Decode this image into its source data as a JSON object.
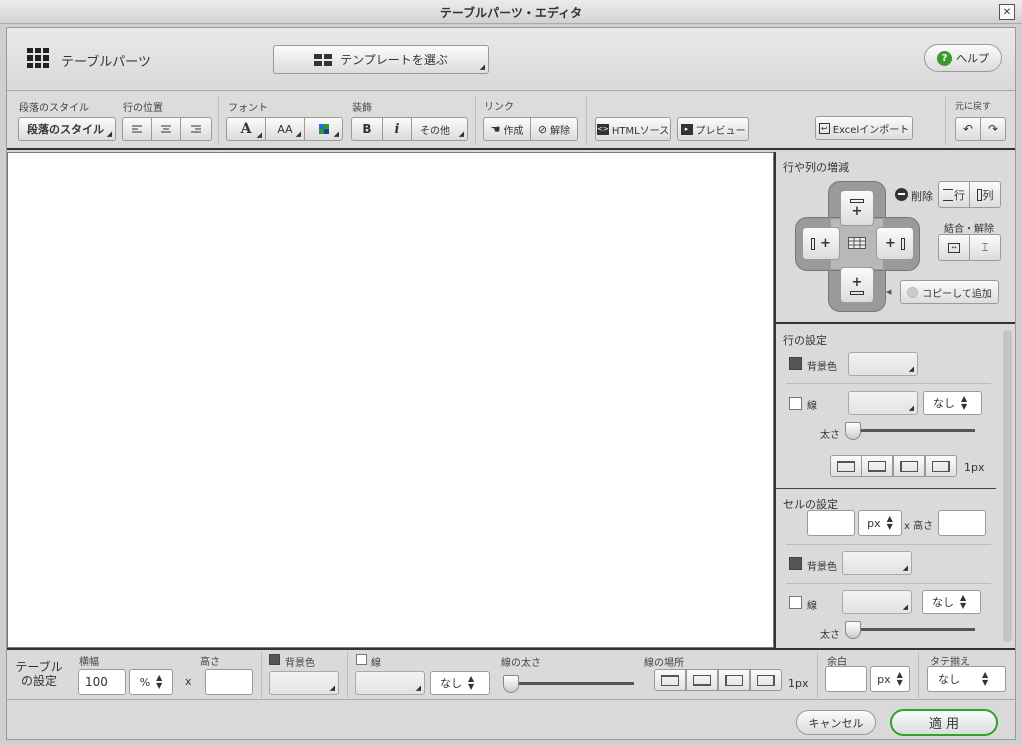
{
  "window": {
    "title": "テーブルパーツ・エディタ",
    "close_glyph": "✕"
  },
  "header": {
    "title": "テーブルパーツ",
    "template_button": "テンプレートを選ぶ",
    "help_button": "ヘルプ"
  },
  "toolbar": {
    "paragraph_style_label": "段落のスタイル",
    "paragraph_style_value": "段落のスタイル",
    "line_position_label": "行の位置",
    "font_label": "フォント",
    "decoration_label": "装飾",
    "font_color_glyph": "A",
    "font_size_glyph": "AA",
    "bold": "B",
    "italic": "i",
    "other": "その他",
    "link_label": "リンク",
    "link_create": "作成",
    "link_remove": "解除",
    "html_source": "HTMLソース",
    "preview": "プレビュー",
    "excel_import": "Excelインポート",
    "undo_label": "元に戻す"
  },
  "row_col_panel": {
    "title": "行や列の増減",
    "delete_label": "削除",
    "row_btn": "行",
    "col_btn": "列",
    "merge_label": "結合・解除",
    "copy_add": "コピーして追加",
    "plus": "+"
  },
  "row_settings": {
    "title": "行の設定",
    "bg_label": "背景色",
    "line_label": "線",
    "line_style": "なし",
    "thickness_label": "太さ",
    "px_value": "1px"
  },
  "cell_settings": {
    "title": "セルの設定",
    "width_unit": "px",
    "x_height": "x 高さ",
    "bg_label": "背景色",
    "line_label": "線",
    "line_style": "なし",
    "thickness_label": "太さ"
  },
  "table_settings": {
    "title_line1": "テーブル",
    "title_line2": "の設定",
    "width_label": "横幅",
    "width_value": "100",
    "width_unit": "%",
    "x": "x",
    "height_label": "高さ",
    "bg_label": "背景色",
    "line_label": "線",
    "line_style": "なし",
    "thickness_label": "線の太さ",
    "location_label": "線の場所",
    "px_value": "1px",
    "margin_label": "余白",
    "margin_unit": "px",
    "valign_label": "タテ揃え",
    "valign_value": "なし"
  },
  "footer": {
    "cancel": "キャンセル",
    "apply": "適 用"
  },
  "colors": {
    "accent_green": "#2aa52a",
    "help_icon": "#3a9a2a"
  }
}
